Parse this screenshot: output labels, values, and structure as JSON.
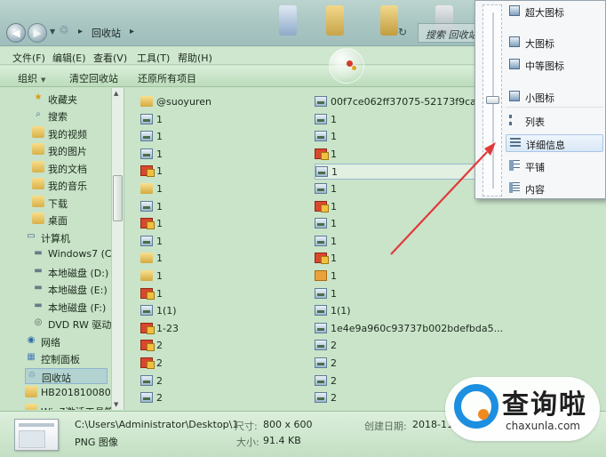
{
  "address_bar": {
    "crumbs": [
      "回收站"
    ],
    "search_placeholder": "搜索 回收站"
  },
  "menu": {
    "items": [
      "文件(F)",
      "编辑(E)",
      "查看(V)",
      "工具(T)",
      "帮助(H)"
    ]
  },
  "commands": {
    "organize": "组织",
    "empty_bin": "清空回收站",
    "restore_all": "还原所有项目"
  },
  "nav": {
    "items": [
      {
        "label": "收藏夹",
        "icon": "star-icon"
      },
      {
        "label": "搜索",
        "icon": "search-icon"
      },
      {
        "label": "我的视频",
        "icon": "folder-icon"
      },
      {
        "label": "我的图片",
        "icon": "folder-icon"
      },
      {
        "label": "我的文档",
        "icon": "folder-icon"
      },
      {
        "label": "我的音乐",
        "icon": "folder-icon"
      },
      {
        "label": "下载",
        "icon": "folder-icon"
      },
      {
        "label": "桌面",
        "icon": "folder-icon"
      },
      {
        "label": "计算机",
        "icon": "computer-icon"
      },
      {
        "label": "Windows7 (C:",
        "icon": "drive-icon"
      },
      {
        "label": "本地磁盘 (D:)",
        "icon": "drive-icon"
      },
      {
        "label": "本地磁盘 (E:)",
        "icon": "drive-icon"
      },
      {
        "label": "本地磁盘 (F:)",
        "icon": "drive-icon"
      },
      {
        "label": "DVD RW 驱动",
        "icon": "dvd-icon"
      },
      {
        "label": "网络",
        "icon": "network-icon"
      },
      {
        "label": "控制面板",
        "icon": "control-panel-icon"
      },
      {
        "label": "回收站",
        "icon": "recycle-bin-icon"
      },
      {
        "label": "HB2018100800",
        "icon": "folder-icon"
      },
      {
        "label": "Win7激活工具箱",
        "icon": "folder-icon"
      }
    ]
  },
  "files": {
    "col1": [
      {
        "name": "@suoyuren",
        "type": "folder"
      },
      {
        "name": "1",
        "type": "image"
      },
      {
        "name": "1",
        "type": "image"
      },
      {
        "name": "1",
        "type": "image"
      },
      {
        "name": "1",
        "type": "red"
      },
      {
        "name": "1",
        "type": "folder"
      },
      {
        "name": "1",
        "type": "image"
      },
      {
        "name": "1",
        "type": "red"
      },
      {
        "name": "1",
        "type": "image"
      },
      {
        "name": "1",
        "type": "folder"
      },
      {
        "name": "1",
        "type": "folder"
      },
      {
        "name": "1",
        "type": "red"
      },
      {
        "name": "1(1)",
        "type": "image"
      },
      {
        "name": "1-23",
        "type": "red"
      },
      {
        "name": "2",
        "type": "red"
      },
      {
        "name": "2",
        "type": "red"
      },
      {
        "name": "2",
        "type": "image"
      },
      {
        "name": "2",
        "type": "image"
      }
    ],
    "col2": [
      {
        "name": "00f7ce062ff37075-52173f9ca184...",
        "type": "image"
      },
      {
        "name": "1",
        "type": "image"
      },
      {
        "name": "1",
        "type": "image"
      },
      {
        "name": "1",
        "type": "red"
      },
      {
        "name": "1",
        "type": "image",
        "selected": true
      },
      {
        "name": "1",
        "type": "image"
      },
      {
        "name": "1",
        "type": "red"
      },
      {
        "name": "1",
        "type": "image"
      },
      {
        "name": "1",
        "type": "image"
      },
      {
        "name": "1",
        "type": "red"
      },
      {
        "name": "1",
        "type": "ppt"
      },
      {
        "name": "1",
        "type": "image"
      },
      {
        "name": "1(1)",
        "type": "image"
      },
      {
        "name": "1e4e9a960c93737b002bdefbda5...",
        "type": "image"
      },
      {
        "name": "2",
        "type": "image"
      },
      {
        "name": "2",
        "type": "image"
      },
      {
        "name": "2",
        "type": "image"
      },
      {
        "name": "2",
        "type": "image"
      }
    ]
  },
  "details": {
    "path": "C:\\Users\\Administrator\\Desktop\\1",
    "type": "PNG 图像",
    "size_key": "尺寸:",
    "size_val": "800 x 600",
    "bytes_key": "大小:",
    "bytes_val": "91.4 KB",
    "created_key": "创建日期:",
    "created_val": "2018-11-"
  },
  "view_menu": {
    "items": [
      {
        "label": "超大图标",
        "icon": "extra-large-icons-icon"
      },
      {
        "label": "大图标",
        "icon": "large-icons-icon"
      },
      {
        "label": "中等图标",
        "icon": "medium-icons-icon"
      },
      {
        "label": "小图标",
        "icon": "small-icons-icon"
      },
      {
        "label": "列表",
        "icon": "list-view-icon"
      },
      {
        "label": "详细信息",
        "icon": "details-view-icon",
        "selected": true
      },
      {
        "label": "平铺",
        "icon": "tiles-view-icon"
      },
      {
        "label": "内容",
        "icon": "content-view-icon"
      }
    ]
  },
  "watermark": {
    "name": "查询啦",
    "url": "chaxunla.com"
  },
  "colors": {
    "annotation_arrow": "#e03a3a",
    "watermark_blue": "#1d8fe0",
    "watermark_orange": "#f28a1e"
  }
}
